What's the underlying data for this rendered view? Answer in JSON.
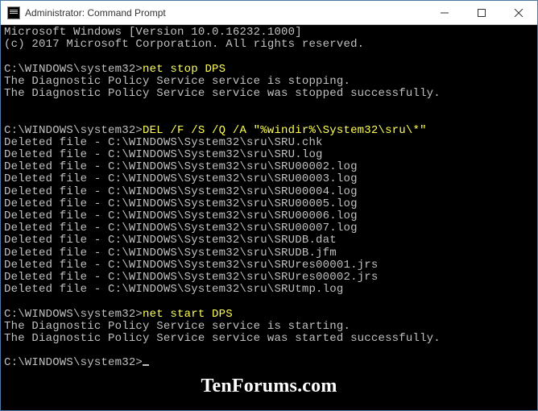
{
  "titlebar": {
    "title": "Administrator: Command Prompt"
  },
  "header": {
    "line1": "Microsoft Windows [Version 10.0.16232.1000]",
    "line2": "(c) 2017 Microsoft Corporation. All rights reserved."
  },
  "prompt": "C:\\WINDOWS\\system32>",
  "commands": {
    "stop": "net stop DPS",
    "del": "DEL /F /S /Q /A \"%windir%\\System32\\sru\\*\"",
    "start": "net start DPS"
  },
  "stop_output": {
    "line1": "The Diagnostic Policy Service service is stopping.",
    "line2": "The Diagnostic Policy Service service was stopped successfully."
  },
  "deleted_prefix": "Deleted file - ",
  "deleted_files": [
    "C:\\WINDOWS\\System32\\sru\\SRU.chk",
    "C:\\WINDOWS\\System32\\sru\\SRU.log",
    "C:\\WINDOWS\\System32\\sru\\SRU00002.log",
    "C:\\WINDOWS\\System32\\sru\\SRU00003.log",
    "C:\\WINDOWS\\System32\\sru\\SRU00004.log",
    "C:\\WINDOWS\\System32\\sru\\SRU00005.log",
    "C:\\WINDOWS\\System32\\sru\\SRU00006.log",
    "C:\\WINDOWS\\System32\\sru\\SRU00007.log",
    "C:\\WINDOWS\\System32\\sru\\SRUDB.dat",
    "C:\\WINDOWS\\System32\\sru\\SRUDB.jfm",
    "C:\\WINDOWS\\System32\\sru\\SRUres00001.jrs",
    "C:\\WINDOWS\\System32\\sru\\SRUres00002.jrs",
    "C:\\WINDOWS\\System32\\sru\\SRUtmp.log"
  ],
  "start_output": {
    "line1": "The Diagnostic Policy Service service is starting.",
    "line2": "The Diagnostic Policy Service service was started successfully."
  },
  "watermark": "TenForums.com"
}
